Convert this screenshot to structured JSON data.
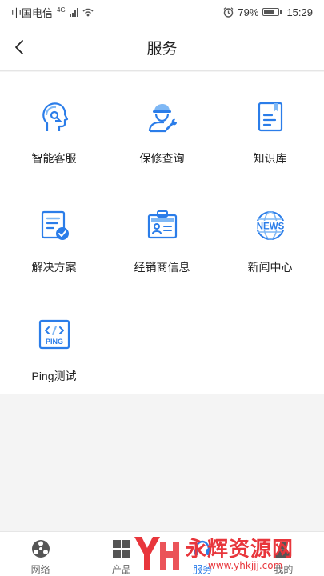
{
  "status_bar": {
    "carrier": "中国电信",
    "network": "4G",
    "battery": "79%",
    "battery_level": 0.79,
    "time": "15:29"
  },
  "header": {
    "title": "服务"
  },
  "services": [
    {
      "label": "智能客服",
      "icon": "headset-agent-icon"
    },
    {
      "label": "保修查询",
      "icon": "repair-person-icon"
    },
    {
      "label": "知识库",
      "icon": "book-icon"
    },
    {
      "label": "解决方案",
      "icon": "document-check-icon"
    },
    {
      "label": "经销商信息",
      "icon": "id-card-icon"
    },
    {
      "label": "新闻中心",
      "icon": "news-globe-icon"
    },
    {
      "label": "Ping测试",
      "icon": "ping-code-icon"
    }
  ],
  "ping_icon_text": "PING",
  "news_icon_text": "NEWS",
  "bottom_nav": [
    {
      "label": "网络",
      "icon": "network-icon",
      "active": false
    },
    {
      "label": "产品",
      "icon": "product-icon",
      "active": false
    },
    {
      "label": "服务",
      "icon": "service-icon",
      "active": true
    },
    {
      "label": "我的",
      "icon": "me-icon",
      "active": false
    }
  ],
  "watermark": {
    "text": "永辉资源网",
    "url": "www.yhkjjj.com"
  },
  "colors": {
    "accent": "#2b7de9",
    "icon_light": "#7fb8f5",
    "watermark": "#e8363c"
  }
}
